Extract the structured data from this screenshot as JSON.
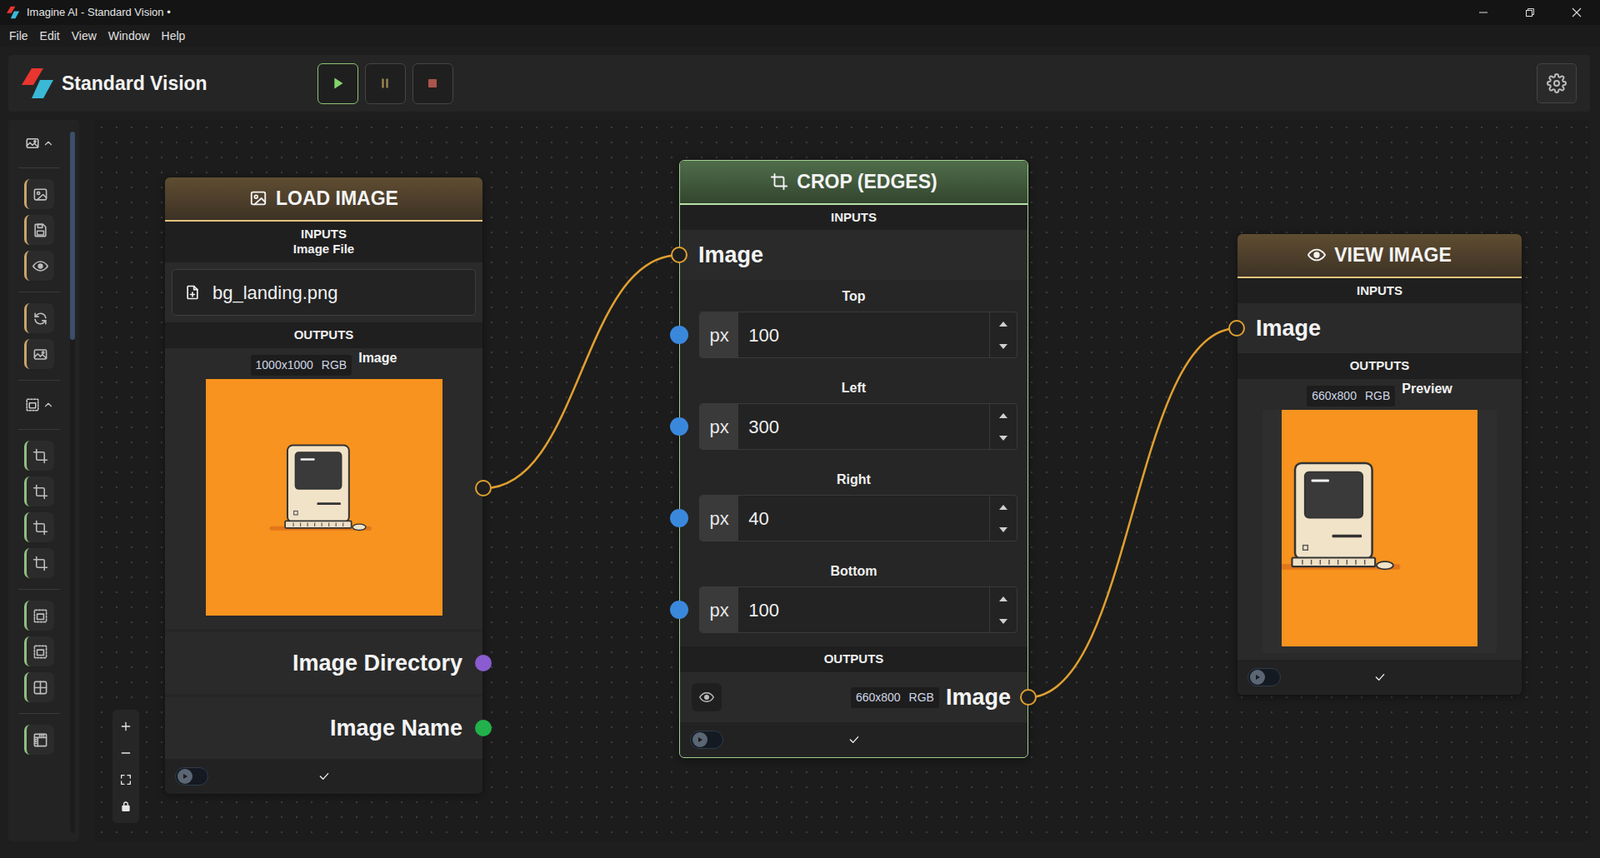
{
  "window": {
    "title": "Imagine AI - Standard Vision •"
  },
  "menu": [
    "File",
    "Edit",
    "View",
    "Window",
    "Help"
  ],
  "app": {
    "title": "Standard Vision"
  },
  "run_controls": [
    {
      "kind": "play",
      "highlighted": true
    },
    {
      "kind": "pause",
      "highlighted": false
    },
    {
      "kind": "stop",
      "highlighted": false
    }
  ],
  "sidebar": {
    "groups": [
      {
        "expanded": true
      },
      {
        "expanded": true
      }
    ]
  },
  "nodes": {
    "load": {
      "title": "LOAD IMAGE",
      "inputs_label": "INPUTS",
      "file_label": "Image File",
      "file": "bg_landing.png",
      "outputs_label": "OUTPUTS",
      "image": {
        "size": "1000x1000",
        "mode": "RGB",
        "label": "Image"
      },
      "extra_outputs": [
        {
          "label": "Image Directory",
          "color": "#8a5cd0"
        },
        {
          "label": "Image Name",
          "color": "#22b14c"
        }
      ],
      "toggle_on": false
    },
    "crop": {
      "title": "CROP (EDGES)",
      "inputs_label": "INPUTS",
      "image_input": "Image",
      "params": [
        {
          "label": "Top",
          "unit": "px",
          "value": "100"
        },
        {
          "label": "Left",
          "unit": "px",
          "value": "300"
        },
        {
          "label": "Right",
          "unit": "px",
          "value": "40"
        },
        {
          "label": "Bottom",
          "unit": "px",
          "value": "100"
        }
      ],
      "outputs_label": "OUTPUTS",
      "output": {
        "size": "660x800",
        "mode": "RGB",
        "label": "Image"
      },
      "toggle_on": false
    },
    "view": {
      "title": "VIEW IMAGE",
      "inputs_label": "INPUTS",
      "image_input": "Image",
      "outputs_label": "OUTPUTS",
      "preview": {
        "size": "660x800",
        "mode": "RGB",
        "label": "Preview"
      },
      "toggle_on": false
    }
  },
  "links": [
    {
      "from": "load-image-out",
      "to": "crop-image-in"
    },
    {
      "from": "crop-image-out",
      "to": "view-image-in"
    }
  ]
}
